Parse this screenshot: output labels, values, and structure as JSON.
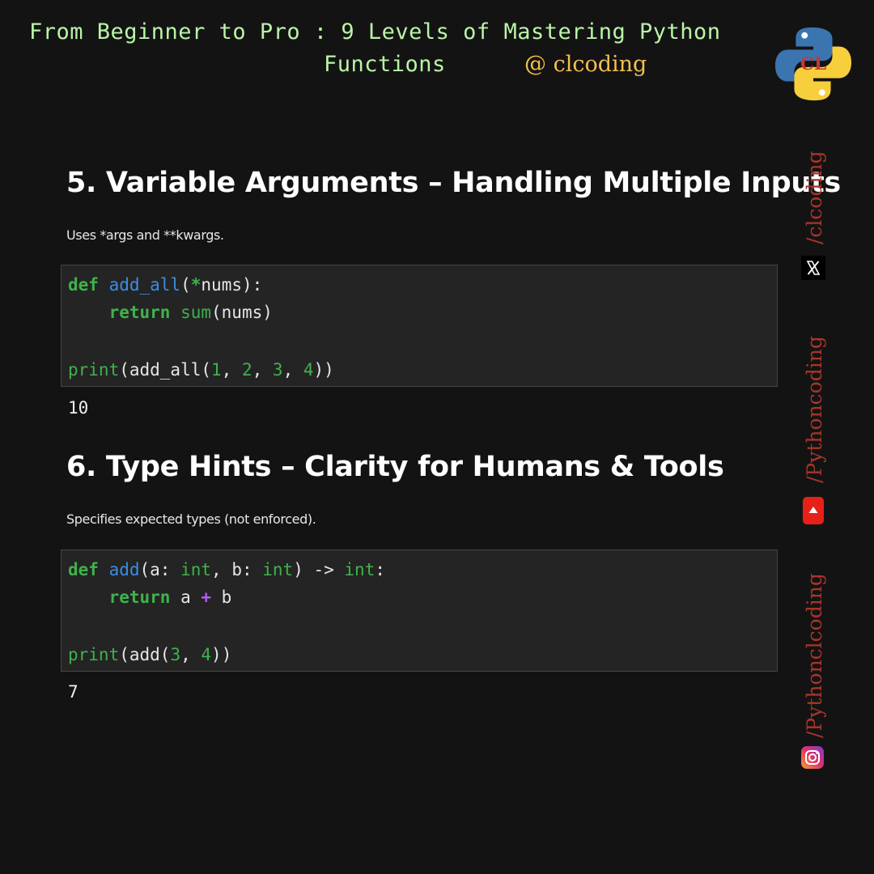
{
  "header": {
    "title_line1": "From Beginner to Pro : 9 Levels of Mastering Python",
    "title_line2": "Functions",
    "handle": "@ clcoding"
  },
  "sections": [
    {
      "title": "5. Variable Arguments – Handling Multiple Inputs",
      "description": "Uses *args and **kwargs.",
      "code": [
        [
          "def ",
          " ",
          "add_all",
          "(",
          "*",
          "nums):"
        ],
        [
          "    return ",
          "sum",
          "(nums)"
        ],
        [
          "print",
          "(add_all(",
          "1",
          ", ",
          "2",
          ", ",
          "3",
          ", ",
          "4",
          "))"
        ]
      ],
      "output": "10"
    },
    {
      "title": "6. Type Hints – Clarity for Humans & Tools",
      "description": "Specifies expected types (not enforced).",
      "code": [
        [
          "def ",
          "add",
          "(a: ",
          "int",
          ", b: ",
          "int",
          ") -> ",
          "int",
          ":"
        ],
        [
          "    return ",
          "a ",
          "+",
          " b"
        ],
        [
          "print",
          "(add(",
          "3",
          ", ",
          "4",
          "))"
        ]
      ],
      "output": "7"
    }
  ],
  "sidebar": {
    "items": [
      {
        "label": "/clcoding",
        "icon": "x-twitter-icon"
      },
      {
        "label": "/Pythoncoding",
        "icon": "youtube-icon"
      },
      {
        "label": "/Pythonclcoding",
        "icon": "instagram-icon"
      }
    ]
  },
  "colors": {
    "background": "#141314",
    "header_text": "#b9f5a6",
    "handle": "#f3c04c",
    "keyword": "#3fb24b",
    "function_name": "#3b8de3",
    "operator": "#b45cf0",
    "sidebar_text": "#a8362a"
  }
}
